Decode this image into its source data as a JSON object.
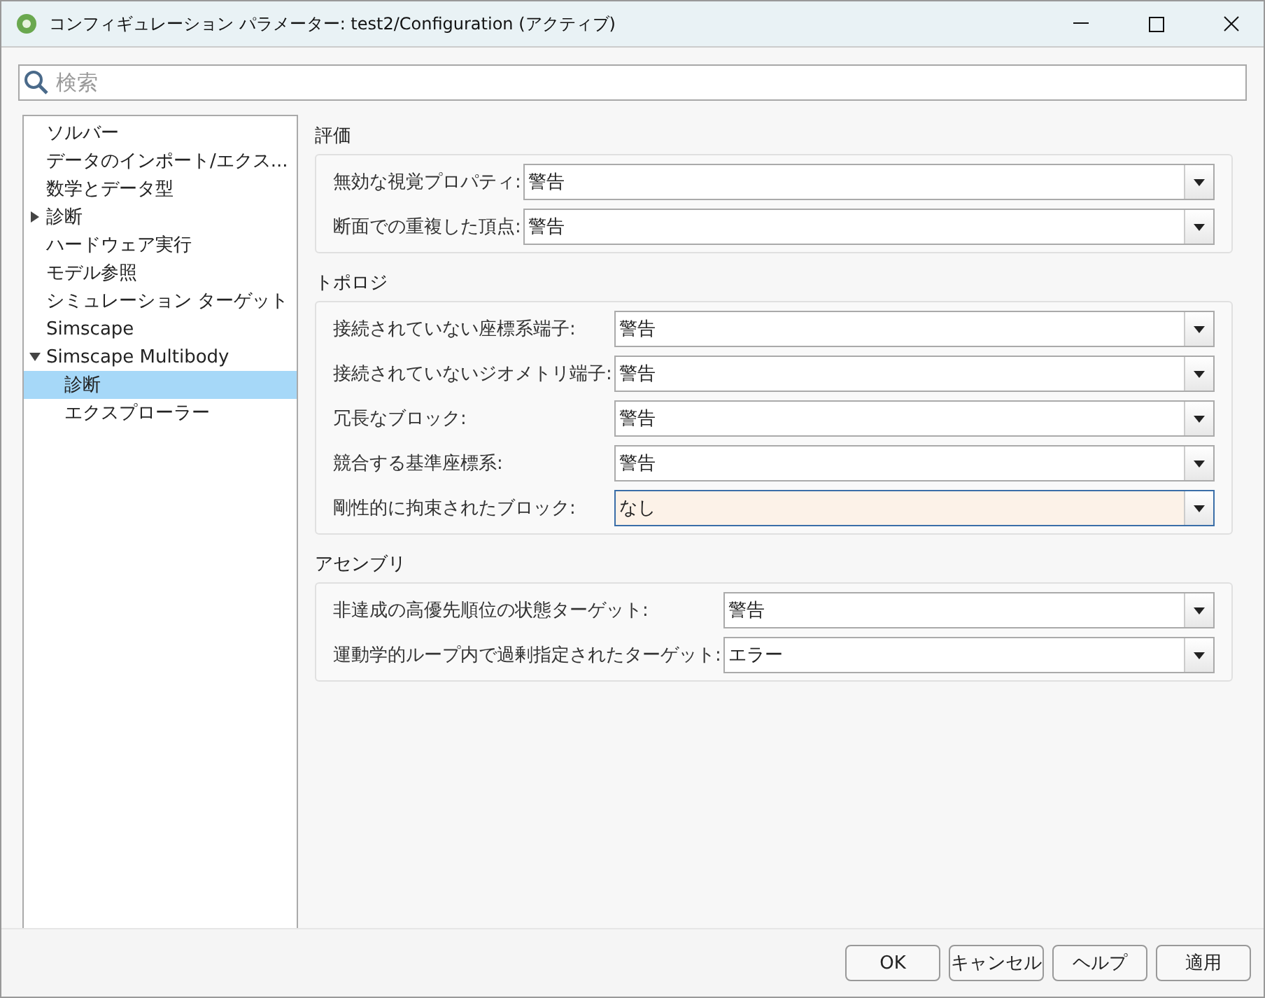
{
  "window": {
    "title": "コンフィギュレーション パラメーター: test2/Configuration (アクティブ)"
  },
  "search": {
    "placeholder": "検索"
  },
  "tree": [
    {
      "label": "ソルバー",
      "selected": false
    },
    {
      "label": "データのインポート/エクス...",
      "selected": false
    },
    {
      "label": "数学とデータ型",
      "selected": false
    },
    {
      "label": "診断",
      "selected": false,
      "expanded": false
    },
    {
      "label": "ハードウェア実行",
      "selected": false
    },
    {
      "label": "モデル参照",
      "selected": false
    },
    {
      "label": "シミュレーション ターゲット",
      "selected": false
    },
    {
      "label": "Simscape",
      "selected": false
    },
    {
      "label": "Simscape Multibody",
      "selected": false,
      "expanded": true,
      "children": [
        {
          "label": "診断",
          "selected": true
        },
        {
          "label": "エクスプローラー",
          "selected": false
        }
      ]
    }
  ],
  "sections": [
    {
      "title": "評価",
      "rows": [
        {
          "label": "無効な視覚プロパティ:",
          "value": "警告",
          "focused": false
        },
        {
          "label": "断面での重複した頂点:",
          "value": "警告",
          "focused": false
        }
      ]
    },
    {
      "title": "トポロジ",
      "rows": [
        {
          "label": "接続されていない座標系端子:",
          "value": "警告",
          "focused": false
        },
        {
          "label": "接続されていないジオメトリ端子:",
          "value": "警告",
          "focused": false
        },
        {
          "label": "冗長なブロック:",
          "value": "警告",
          "focused": false
        },
        {
          "label": "競合する基準座標系:",
          "value": "警告",
          "focused": false
        },
        {
          "label": "剛性的に拘束されたブロック:",
          "value": "なし",
          "focused": true
        }
      ]
    },
    {
      "title": "アセンブリ",
      "rows": [
        {
          "label": "非達成の高優先順位の状態ターゲット:",
          "value": "警告",
          "focused": false
        },
        {
          "label": "運動学的ループ内で過剰指定されたターゲット:",
          "value": "エラー",
          "focused": false
        }
      ]
    }
  ],
  "buttons": [
    "OK",
    "キャンセル",
    "ヘルプ",
    "適用"
  ]
}
